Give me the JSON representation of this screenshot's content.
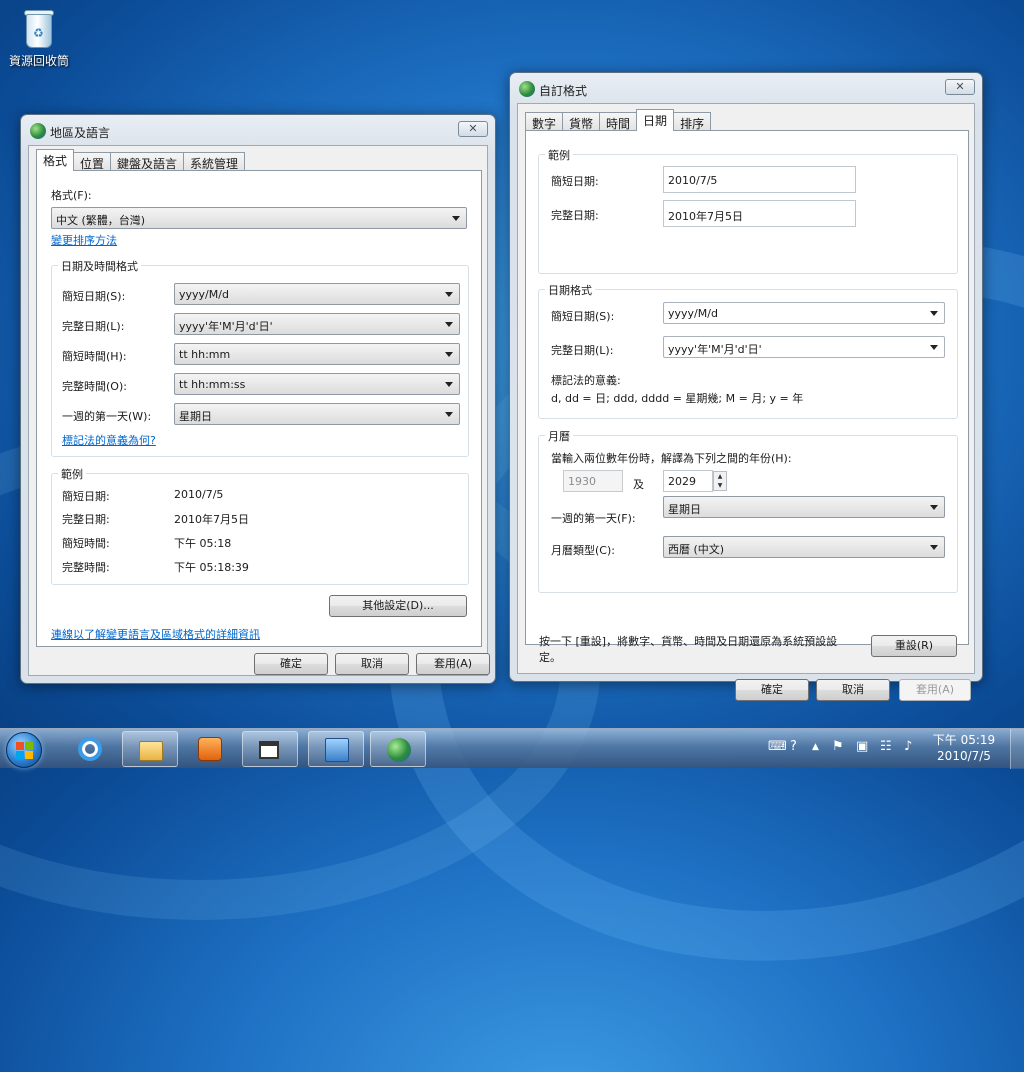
{
  "desktop": {
    "recycle_bin_label": "資源回收筒"
  },
  "region_window": {
    "title": "地區及語言",
    "tabs": [
      "格式",
      "位置",
      "鍵盤及語言",
      "系統管理"
    ],
    "format_label": "格式(F):",
    "format_value": "中文 (繁體，台灣)",
    "change_sort_link": "變更排序方法",
    "datetime_group_title": "日期及時間格式",
    "rows": [
      {
        "label": "簡短日期(S):",
        "value": "yyyy/M/d"
      },
      {
        "label": "完整日期(L):",
        "value": "yyyy'年'M'月'd'日'"
      },
      {
        "label": "簡短時間(H):",
        "value": "tt hh:mm"
      },
      {
        "label": "完整時間(O):",
        "value": "tt hh:mm:ss"
      },
      {
        "label": "一週的第一天(W):",
        "value": "星期日"
      }
    ],
    "notation_link": "標記法的意義為何?",
    "examples_group_title": "範例",
    "examples": [
      {
        "label": "簡短日期:",
        "value": "2010/7/5"
      },
      {
        "label": "完整日期:",
        "value": "2010年7月5日"
      },
      {
        "label": "簡短時間:",
        "value": "下午 05:18"
      },
      {
        "label": "完整時間:",
        "value": "下午 05:18:39"
      }
    ],
    "other_settings_button": "其他設定(D)...",
    "details_link": "連線以了解變更語言及區域格式的詳細資訊",
    "ok_button": "確定",
    "cancel_button": "取消",
    "apply_button": "套用(A)"
  },
  "custom_window": {
    "title": "自訂格式",
    "tabs": [
      "數字",
      "貨幣",
      "時間",
      "日期",
      "排序"
    ],
    "examples_group_title": "範例",
    "short_date_label": "簡短日期:",
    "short_date_value": "2010/7/5",
    "long_date_label": "完整日期:",
    "long_date_value": "2010年7月5日",
    "date_format_group_title": "日期格式",
    "short_date_combo_label": "簡短日期(S):",
    "short_date_combo_value": "yyyy/M/d",
    "long_date_combo_label": "完整日期(L):",
    "long_date_combo_value": "yyyy'年'M'月'd'日'",
    "notation_title": "標記法的意義:",
    "notation_text": "d, dd = 日;  ddd, dddd = 星期幾;  M = 月;  y = 年",
    "calendar_group_title": "月曆",
    "two_digit_text": "當輸入兩位數年份時，解譯為下列之間的年份(H):",
    "year_from": "1930",
    "and_label": "及",
    "year_to": "2029",
    "first_day_label": "一週的第一天(F):",
    "first_day_value": "星期日",
    "calendar_type_label": "月曆類型(C):",
    "calendar_type_value": "西曆 (中文)",
    "reset_text_1": "按一下 [重設]，將數字、貨幣、時間及日期還原為系統預設設",
    "reset_text_2": "定。",
    "reset_button": "重設(R)",
    "ok_button": "確定",
    "cancel_button": "取消",
    "apply_button": "套用(A)"
  },
  "taskbar": {
    "icons": [
      "internet-explorer-icon",
      "file-explorer-icon",
      "media-player-icon",
      "window-app-icon",
      "control-panel-icon",
      "region-globe-icon"
    ],
    "time": "下午 05:19",
    "date": "2010/7/5"
  }
}
